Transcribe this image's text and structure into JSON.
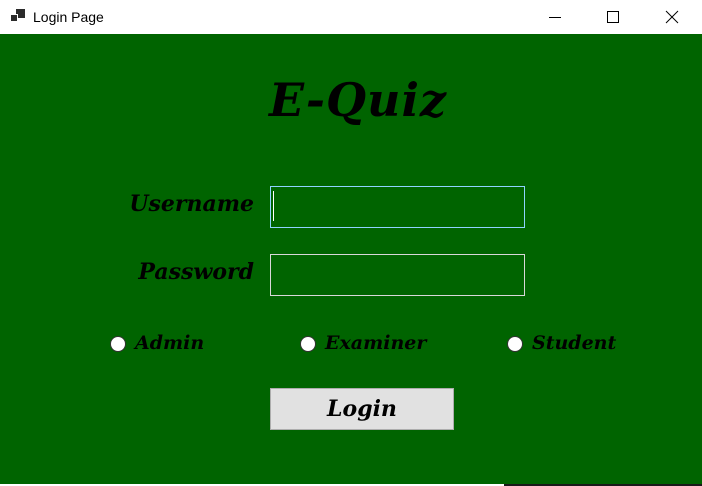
{
  "window": {
    "title": "Login Page",
    "icon": "app-window-icon",
    "controls": [
      "minimize-icon",
      "maximize-icon",
      "close-icon"
    ]
  },
  "app": {
    "heading": "E-Quiz"
  },
  "form": {
    "username_label": "Username",
    "username_value": "",
    "password_label": "Password",
    "password_value": ""
  },
  "roles": {
    "options": [
      {
        "label": "Admin",
        "selected": false
      },
      {
        "label": "Examiner",
        "selected": false
      },
      {
        "label": "Student",
        "selected": false
      }
    ]
  },
  "actions": {
    "login_label": "Login"
  },
  "colors": {
    "background": "#006400",
    "text": "#000000",
    "button": "#e1e1e1",
    "focus_border": "#8fd3ff"
  }
}
